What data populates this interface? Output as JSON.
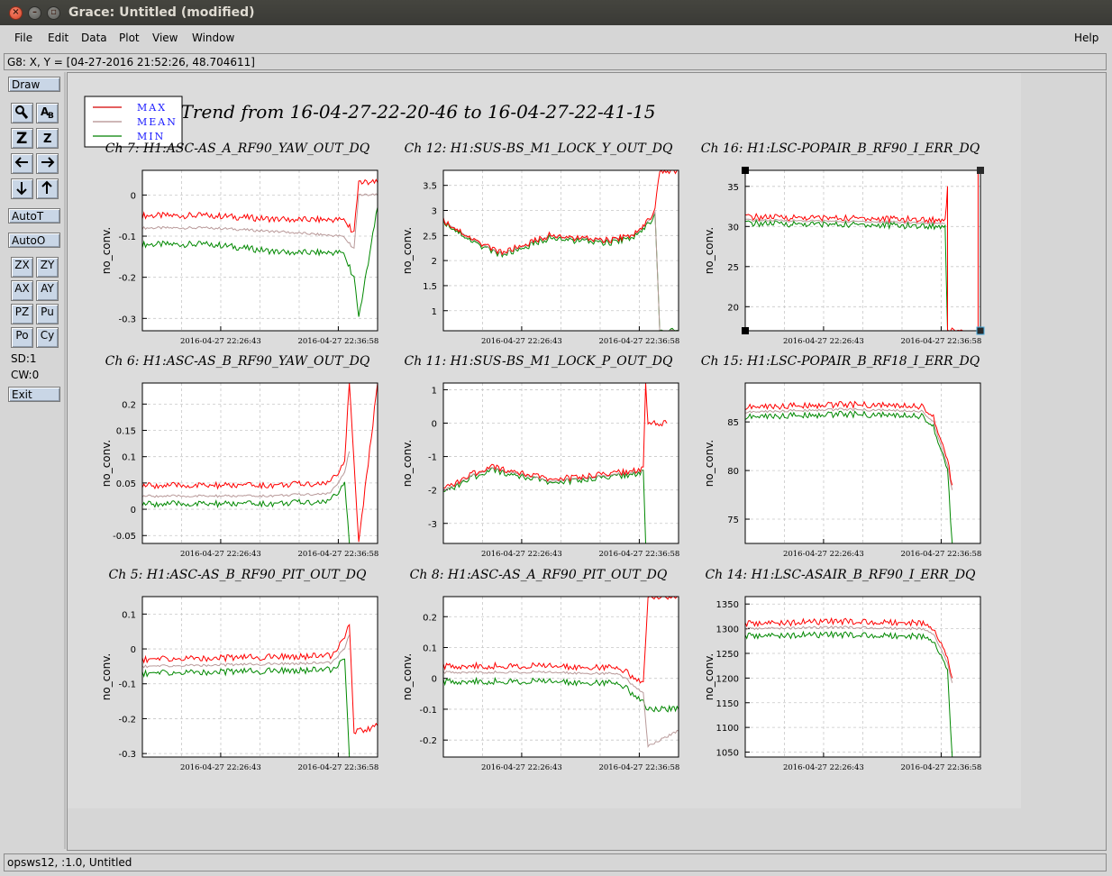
{
  "window": {
    "title": "Grace: Untitled (modified)",
    "controls": [
      "close-icon",
      "minimize-icon",
      "maximize-icon"
    ]
  },
  "menubar": {
    "items": [
      {
        "label": "File"
      },
      {
        "label": "Edit"
      },
      {
        "label": "Data"
      },
      {
        "label": "Plot"
      },
      {
        "label": "View"
      },
      {
        "label": "Window"
      }
    ],
    "help": "Help"
  },
  "locator": "G8: X, Y = [04-27-2016 21:52:26, 48.704611]",
  "toolbar": {
    "draw": "Draw",
    "autot": "AutoT",
    "autoo": "AutoO",
    "icons": [
      {
        "name": "zoom-icon",
        "glyph": "🔍"
      },
      {
        "name": "text-icon",
        "glyph": "Aᵇ"
      },
      {
        "name": "zoom-in-icon",
        "glyph": "Z"
      },
      {
        "name": "zoom-out-icon",
        "glyph": "z"
      },
      {
        "name": "arrow-left-icon",
        "glyph": "←"
      },
      {
        "name": "arrow-right-icon",
        "glyph": "→"
      },
      {
        "name": "arrow-down-icon",
        "glyph": "↓"
      },
      {
        "name": "arrow-up-icon",
        "glyph": "↑"
      }
    ],
    "small_buttons": [
      "ZX",
      "ZY",
      "AX",
      "AY",
      "PZ",
      "Pu",
      "Po",
      "Cy"
    ],
    "sd": "SD:1",
    "cw": "CW:0",
    "exit": "Exit"
  },
  "status": "opsws12, :1.0, Untitled",
  "plot_title": "Trend from 16-04-27-22-20-46 to 16-04-27-22-41-15",
  "legend": [
    {
      "label": "MAX",
      "color": "#d40000"
    },
    {
      "label": "MEAN",
      "color": "#b08c8c"
    },
    {
      "label": "MIN",
      "color": "#008000"
    }
  ],
  "colors": {
    "max": "#ff0000",
    "mean": "#b99a9a",
    "min": "#008800",
    "grid": "#c8c8c8",
    "legend_text": "#1a1aff"
  },
  "chart_data": [
    {
      "type": "line",
      "title": "Ch 7: H1:ASC-AS_A_RF90_YAW_OUT_DQ",
      "ylabel": "no_conv.",
      "xticks": [
        "2016-04-27 22:26:43",
        "2016-04-27 22:36:58"
      ],
      "yticks": [
        "0",
        "-0.1",
        "-0.2",
        "-0.3"
      ],
      "ylim": [
        -0.33,
        0.06
      ],
      "series": [
        {
          "name": "MAX",
          "points": [
            [
              0,
              -0.05
            ],
            [
              0.3,
              -0.05
            ],
            [
              0.6,
              -0.06
            ],
            [
              0.85,
              -0.06
            ],
            [
              0.9,
              -0.09
            ],
            [
              0.92,
              0.03
            ],
            [
              1,
              0.03
            ]
          ]
        },
        {
          "name": "MEAN",
          "points": [
            [
              0,
              -0.08
            ],
            [
              0.3,
              -0.08
            ],
            [
              0.6,
              -0.09
            ],
            [
              0.85,
              -0.1
            ],
            [
              0.9,
              -0.13
            ],
            [
              0.92,
              0.0
            ],
            [
              1,
              0.0
            ]
          ]
        },
        {
          "name": "MIN",
          "points": [
            [
              0,
              -0.12
            ],
            [
              0.3,
              -0.12
            ],
            [
              0.6,
              -0.14
            ],
            [
              0.85,
              -0.14
            ],
            [
              0.9,
              -0.2
            ],
            [
              0.92,
              -0.3
            ],
            [
              1,
              -0.03
            ]
          ]
        }
      ]
    },
    {
      "type": "line",
      "title": "Ch 12: H1:SUS-BS_M1_LOCK_Y_OUT_DQ",
      "ylabel": "no_conv.",
      "xticks": [
        "2016-04-27 22:26:43",
        "2016-04-27 22:36:58"
      ],
      "yticks": [
        "3.5",
        "3",
        "2.5",
        "2",
        "1.5",
        "1"
      ],
      "ylim": [
        0.6,
        3.8
      ],
      "series": [
        {
          "name": "MAX",
          "points": [
            [
              0,
              2.8
            ],
            [
              0.15,
              2.35
            ],
            [
              0.25,
              2.15
            ],
            [
              0.45,
              2.5
            ],
            [
              0.55,
              2.45
            ],
            [
              0.7,
              2.4
            ],
            [
              0.83,
              2.55
            ],
            [
              0.9,
              3.0
            ],
            [
              0.92,
              3.8
            ],
            [
              1,
              3.8
            ]
          ]
        },
        {
          "name": "MEAN",
          "points": [
            [
              0,
              2.8
            ],
            [
              0.15,
              2.35
            ],
            [
              0.25,
              2.12
            ],
            [
              0.45,
              2.5
            ],
            [
              0.55,
              2.45
            ],
            [
              0.7,
              2.4
            ],
            [
              0.83,
              2.55
            ],
            [
              0.9,
              2.95
            ],
            [
              0.92,
              0.6
            ],
            [
              1,
              0.6
            ]
          ]
        },
        {
          "name": "MIN",
          "points": [
            [
              0,
              2.78
            ],
            [
              0.15,
              2.3
            ],
            [
              0.25,
              2.1
            ],
            [
              0.45,
              2.45
            ],
            [
              0.55,
              2.4
            ],
            [
              0.7,
              2.35
            ],
            [
              0.83,
              2.5
            ],
            [
              0.9,
              2.9
            ],
            [
              0.92,
              0.6
            ],
            [
              1,
              0.6
            ]
          ]
        }
      ]
    },
    {
      "type": "line",
      "title": "Ch 16: H1:LSC-POPAIR_B_RF90_I_ERR_DQ",
      "ylabel": "no_conv.",
      "xticks": [
        "2016-04-27 22:26:43",
        "2016-04-27 22:36:58"
      ],
      "yticks": [
        "35",
        "30",
        "25",
        "20"
      ],
      "ylim": [
        17,
        37
      ],
      "series": [
        {
          "name": "MAX",
          "points": [
            [
              0,
              31.2
            ],
            [
              0.5,
              31.0
            ],
            [
              0.85,
              30.8
            ],
            [
              0.86,
              35.0
            ],
            [
              0.86,
              17
            ],
            [
              0.99,
              17
            ],
            [
              0.99,
              37
            ],
            [
              1,
              37
            ]
          ]
        },
        {
          "name": "MEAN",
          "points": [
            [
              0,
              30.8
            ],
            [
              0.5,
              30.6
            ],
            [
              0.85,
              30.4
            ]
          ]
        },
        {
          "name": "MIN",
          "points": [
            [
              0,
              30.4
            ],
            [
              0.5,
              30.2
            ],
            [
              0.85,
              30.0
            ],
            [
              0.86,
              17
            ]
          ]
        }
      ]
    },
    {
      "type": "line",
      "title": "Ch 6: H1:ASC-AS_B_RF90_YAW_OUT_DQ",
      "ylabel": "no_conv.",
      "xticks": [
        "2016-04-27 22:26:43",
        "2016-04-27 22:36:58"
      ],
      "yticks": [
        "0.2",
        "0.15",
        "0.1",
        "0.05",
        "0",
        "-0.05"
      ],
      "ylim": [
        -0.065,
        0.24
      ],
      "series": [
        {
          "name": "MAX",
          "points": [
            [
              0,
              0.045
            ],
            [
              0.5,
              0.045
            ],
            [
              0.8,
              0.05
            ],
            [
              0.86,
              0.09
            ],
            [
              0.88,
              0.24
            ],
            [
              0.92,
              -0.065
            ],
            [
              1,
              0.24
            ]
          ]
        },
        {
          "name": "MEAN",
          "points": [
            [
              0,
              0.025
            ],
            [
              0.5,
              0.025
            ],
            [
              0.8,
              0.03
            ],
            [
              0.86,
              0.07
            ],
            [
              0.88,
              0.11
            ]
          ]
        },
        {
          "name": "MIN",
          "points": [
            [
              0,
              0.01
            ],
            [
              0.5,
              0.01
            ],
            [
              0.8,
              0.015
            ],
            [
              0.86,
              0.05
            ],
            [
              0.88,
              -0.065
            ]
          ]
        }
      ]
    },
    {
      "type": "line",
      "title": "Ch 11: H1:SUS-BS_M1_LOCK_P_OUT_DQ",
      "ylabel": "no_conv.",
      "xticks": [
        "2016-04-27 22:26:43",
        "2016-04-27 22:36:58"
      ],
      "yticks": [
        "1",
        "0",
        "-1",
        "-2",
        "-3"
      ],
      "ylim": [
        -3.6,
        1.2
      ],
      "series": [
        {
          "name": "MAX",
          "points": [
            [
              0,
              -2.0
            ],
            [
              0.1,
              -1.6
            ],
            [
              0.2,
              -1.3
            ],
            [
              0.35,
              -1.5
            ],
            [
              0.45,
              -1.7
            ],
            [
              0.6,
              -1.6
            ],
            [
              0.85,
              -1.4
            ],
            [
              0.86,
              1.2
            ],
            [
              0.87,
              0.0
            ],
            [
              0.95,
              0.0
            ]
          ]
        },
        {
          "name": "MEAN",
          "points": [
            [
              0,
              -2.05
            ],
            [
              0.1,
              -1.65
            ],
            [
              0.2,
              -1.35
            ],
            [
              0.35,
              -1.55
            ],
            [
              0.45,
              -1.75
            ],
            [
              0.6,
              -1.65
            ],
            [
              0.85,
              -1.45
            ]
          ]
        },
        {
          "name": "MIN",
          "points": [
            [
              0,
              -2.1
            ],
            [
              0.1,
              -1.7
            ],
            [
              0.2,
              -1.4
            ],
            [
              0.35,
              -1.6
            ],
            [
              0.45,
              -1.8
            ],
            [
              0.6,
              -1.7
            ],
            [
              0.85,
              -1.5
            ],
            [
              0.86,
              -3.6
            ]
          ]
        }
      ]
    },
    {
      "type": "line",
      "title": "Ch 15: H1:LSC-POPAIR_B_RF18_I_ERR_DQ",
      "ylabel": "no_conv.",
      "xticks": [
        "2016-04-27 22:26:43",
        "2016-04-27 22:36:58"
      ],
      "yticks": [
        "85",
        "80",
        "75"
      ],
      "ylim": [
        72.5,
        89
      ],
      "series": [
        {
          "name": "MAX",
          "points": [
            [
              0,
              86.5
            ],
            [
              0.4,
              86.8
            ],
            [
              0.75,
              86.6
            ],
            [
              0.8,
              85.5
            ],
            [
              0.86,
              81
            ],
            [
              0.88,
              78.5
            ]
          ]
        },
        {
          "name": "MEAN",
          "points": [
            [
              0,
              86.0
            ],
            [
              0.4,
              86.3
            ],
            [
              0.75,
              86.1
            ],
            [
              0.8,
              85.0
            ],
            [
              0.86,
              80.5
            ],
            [
              0.88,
              78
            ]
          ]
        },
        {
          "name": "MIN",
          "points": [
            [
              0,
              85.5
            ],
            [
              0.4,
              85.8
            ],
            [
              0.75,
              85.6
            ],
            [
              0.8,
              84.5
            ],
            [
              0.86,
              80
            ],
            [
              0.88,
              72.5
            ]
          ]
        }
      ]
    },
    {
      "type": "line",
      "title": "Ch 5: H1:ASC-AS_B_RF90_PIT_OUT_DQ",
      "ylabel": "no_conv.",
      "xticks": [
        "2016-04-27 22:26:43",
        "2016-04-27 22:36:58"
      ],
      "yticks": [
        "0.1",
        "0",
        "-0.1",
        "-0.2",
        "-0.3"
      ],
      "ylim": [
        -0.31,
        0.15
      ],
      "series": [
        {
          "name": "MAX",
          "points": [
            [
              0,
              -0.03
            ],
            [
              0.4,
              -0.025
            ],
            [
              0.8,
              -0.02
            ],
            [
              0.86,
              0.03
            ],
            [
              0.88,
              0.07
            ],
            [
              0.9,
              -0.24
            ],
            [
              1,
              -0.22
            ]
          ]
        },
        {
          "name": "MEAN",
          "points": [
            [
              0,
              -0.05
            ],
            [
              0.4,
              -0.045
            ],
            [
              0.8,
              -0.04
            ],
            [
              0.86,
              0.0
            ],
            [
              0.88,
              0.04
            ]
          ]
        },
        {
          "name": "MIN",
          "points": [
            [
              0,
              -0.07
            ],
            [
              0.4,
              -0.065
            ],
            [
              0.8,
              -0.06
            ],
            [
              0.86,
              -0.03
            ],
            [
              0.88,
              -0.31
            ]
          ]
        }
      ]
    },
    {
      "type": "line",
      "title": "Ch 8: H1:ASC-AS_A_RF90_PIT_OUT_DQ",
      "ylabel": "no_conv.",
      "xticks": [
        "2016-04-27 22:26:43",
        "2016-04-27 22:36:58"
      ],
      "yticks": [
        "0.2",
        "0.1",
        "0",
        "-0.1",
        "-0.2"
      ],
      "ylim": [
        -0.255,
        0.265
      ],
      "series": [
        {
          "name": "MAX",
          "points": [
            [
              0,
              0.04
            ],
            [
              0.4,
              0.04
            ],
            [
              0.75,
              0.035
            ],
            [
              0.85,
              -0.02
            ],
            [
              0.87,
              0.265
            ],
            [
              1,
              0.265
            ]
          ]
        },
        {
          "name": "MEAN",
          "points": [
            [
              0,
              0.02
            ],
            [
              0.4,
              0.02
            ],
            [
              0.75,
              0.015
            ],
            [
              0.85,
              -0.05
            ],
            [
              0.87,
              -0.22
            ],
            [
              1,
              -0.17
            ]
          ]
        },
        {
          "name": "MIN",
          "points": [
            [
              0,
              -0.01
            ],
            [
              0.4,
              -0.01
            ],
            [
              0.75,
              -0.015
            ],
            [
              0.85,
              -0.08
            ],
            [
              0.87,
              -0.1
            ],
            [
              1,
              -0.1
            ]
          ]
        }
      ]
    },
    {
      "type": "line",
      "title": "Ch 14: H1:LSC-ASAIR_B_RF90_I_ERR_DQ",
      "ylabel": "no_conv.",
      "xticks": [
        "2016-04-27 22:26:43",
        "2016-04-27 22:36:58"
      ],
      "yticks": [
        "1350",
        "1300",
        "1250",
        "1200",
        "1150",
        "1100",
        "1050"
      ],
      "ylim": [
        1040,
        1365
      ],
      "series": [
        {
          "name": "MAX",
          "points": [
            [
              0,
              1310
            ],
            [
              0.4,
              1315
            ],
            [
              0.75,
              1312
            ],
            [
              0.8,
              1300
            ],
            [
              0.86,
              1240
            ],
            [
              0.88,
              1200
            ]
          ]
        },
        {
          "name": "MEAN",
          "points": [
            [
              0,
              1300
            ],
            [
              0.4,
              1303
            ],
            [
              0.75,
              1300
            ],
            [
              0.8,
              1290
            ],
            [
              0.86,
              1230
            ],
            [
              0.88,
              1190
            ]
          ]
        },
        {
          "name": "MIN",
          "points": [
            [
              0,
              1285
            ],
            [
              0.4,
              1288
            ],
            [
              0.75,
              1285
            ],
            [
              0.8,
              1275
            ],
            [
              0.86,
              1215
            ],
            [
              0.88,
              1040
            ]
          ]
        }
      ]
    }
  ]
}
